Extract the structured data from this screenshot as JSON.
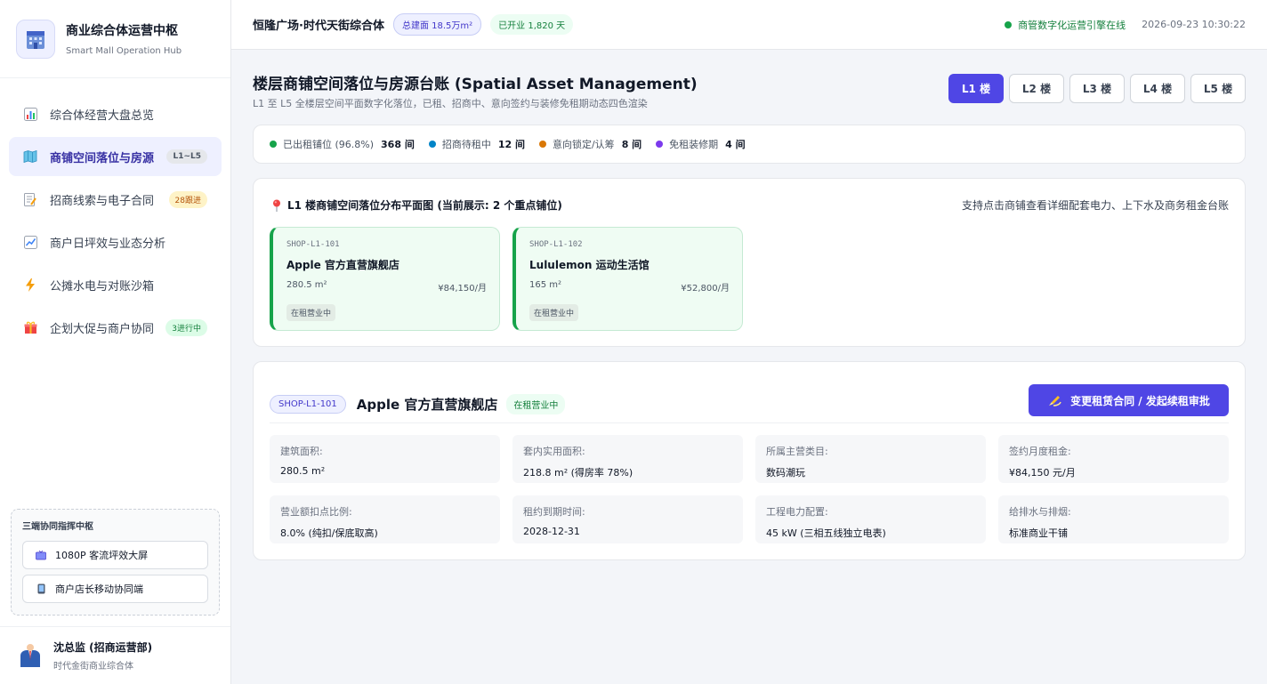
{
  "brand": {
    "title": "商业综合体运营中枢",
    "subtitle": "Smart Mall Operation Hub"
  },
  "nav": {
    "items": [
      {
        "label": "综合体经营大盘总览",
        "icon": "bar-chart-icon",
        "badge": ""
      },
      {
        "label": "商铺空间落位与房源",
        "icon": "map-icon",
        "badge": "L1~L5"
      },
      {
        "label": "招商线索与电子合同",
        "icon": "memo-icon",
        "badge": "28跟进"
      },
      {
        "label": "商户日坪效与业态分析",
        "icon": "trend-icon",
        "badge": ""
      },
      {
        "label": "公摊水电与对账沙箱",
        "icon": "lightning-icon",
        "badge": ""
      },
      {
        "label": "企划大促与商户协同",
        "icon": "gift-icon",
        "badge": "3进行中"
      }
    ]
  },
  "collab": {
    "title": "三端协同指挥中枢",
    "buttons": [
      {
        "label": "1080P 客流坪效大屏",
        "icon": "tv-icon"
      },
      {
        "label": "商户店长移动协同端",
        "icon": "mobile-icon"
      }
    ]
  },
  "user": {
    "name": "沈总监 (招商运营部)",
    "org": "时代金街商业综合体"
  },
  "topbar": {
    "mall_name": "恒隆广场·时代天街综合体",
    "area_pill": "总建面 18.5万m²",
    "days_pill": "已开业 1,820 天",
    "online": "商管数字化运营引擎在线",
    "datetime": "2026-09-23 10:30:22"
  },
  "page": {
    "title": "楼层商铺空间落位与房源台账 (Spatial Asset Management)",
    "subtitle": "L1 至 L5 全楼层空间平面数字化落位，已租、招商中、意向签约与装修免租期动态四色渲染"
  },
  "floors": [
    "L1 楼",
    "L2 楼",
    "L3 楼",
    "L4 楼",
    "L5 楼"
  ],
  "stats": [
    {
      "label": "已出租铺位 (96.8%)",
      "count": "368 间",
      "color": "#16a34a"
    },
    {
      "label": "招商待租中",
      "count": "12 间",
      "color": "#0284c7"
    },
    {
      "label": "意向锁定/认筹",
      "count": "8 间",
      "color": "#d97706"
    },
    {
      "label": "免租装修期",
      "count": "4 间",
      "color": "#7c3aed"
    }
  ],
  "plan": {
    "title": "L1 楼商铺空间落位分布平面图 (当前展示: 2 个重点铺位)",
    "hint": "支持点击商铺查看详细配套电力、上下水及商务租金台账"
  },
  "shops": [
    {
      "code": "SHOP-L1-101",
      "name": "Apple 官方直营旗舰店",
      "area": "280.5 m²",
      "rent": "¥84,150/月",
      "status": "在租营业中"
    },
    {
      "code": "SHOP-L1-102",
      "name": "Lululemon 运动生活馆",
      "area": "165 m²",
      "rent": "¥52,800/月",
      "status": "在租营业中"
    }
  ],
  "detail": {
    "code": "SHOP-L1-101",
    "name": "Apple 官方直营旗舰店",
    "status": "在租营业中",
    "action": "变更租赁合同 / 发起续租审批",
    "fields": [
      {
        "label": "建筑面积:",
        "value": "280.5 m²"
      },
      {
        "label": "套内实用面积:",
        "value": "218.8 m² (得房率 78%)"
      },
      {
        "label": "所属主营类目:",
        "value": "数码潮玩"
      },
      {
        "label": "签约月度租金:",
        "value": "¥84,150 元/月"
      },
      {
        "label": "营业额扣点比例:",
        "value": "8.0% (纯扣/保底取高)"
      },
      {
        "label": "租约到期时间:",
        "value": "2028-12-31"
      },
      {
        "label": "工程电力配置:",
        "value": "45 kW (三相五线独立电表)"
      },
      {
        "label": "给排水与排烟:",
        "value": "标准商业干铺"
      }
    ]
  },
  "colors": {
    "accent": "#4f46e5",
    "leased": "#16a34a",
    "online": "#16a34a"
  }
}
